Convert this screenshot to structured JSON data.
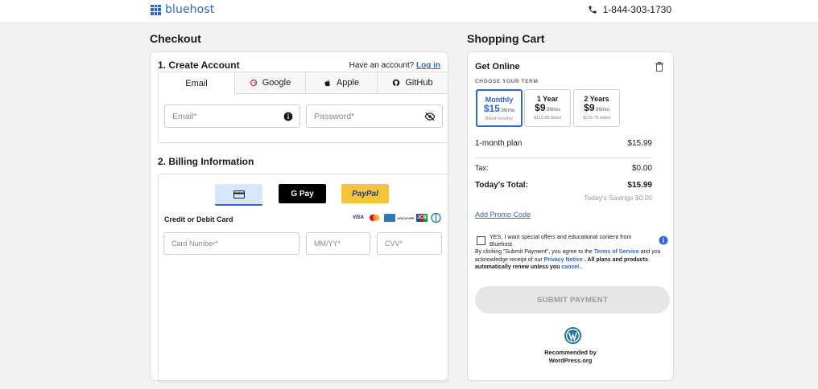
{
  "header": {
    "logo_text": "bluehost",
    "phone": "1-844-303-1730"
  },
  "checkout": {
    "title": "Checkout",
    "create_account": "1. Create Account",
    "have_account": "Have an account?",
    "login": "Log in",
    "tabs": [
      {
        "label": "Email",
        "icon": "envelope"
      },
      {
        "label": "Google",
        "icon": "google-icon"
      },
      {
        "label": "Apple",
        "icon": "apple-icon"
      },
      {
        "label": "GitHub",
        "icon": "github-icon"
      }
    ],
    "email_placeholder": "Email*",
    "password_placeholder": "Password*",
    "billing_title": "2. Billing Information",
    "pay_options": {
      "card": "card-icon",
      "gpay": "G Pay",
      "paypal": "PayPal"
    },
    "card_label": "Credit or Debit Card",
    "brands": [
      "VISA",
      "mastercard",
      "amex",
      "DISCOVER",
      "JCB",
      "Diners"
    ],
    "card_number_placeholder": "Card Number*",
    "expiry_placeholder": "MM/YY*",
    "cvv_placeholder": "CVV*"
  },
  "cart": {
    "title": "Shopping Cart",
    "product": "Get Online",
    "choose_term": "CHOOSE YOUR TERM",
    "terms": [
      {
        "name": "Monthly",
        "price": "$15",
        "cents": ".99/mo",
        "billed": "Billed monthly",
        "selected": true
      },
      {
        "name": "1 Year",
        "price": "$9",
        "cents": ".99/mo",
        "billed": "$119.88 billed",
        "selected": false
      },
      {
        "name": "2 Years",
        "price": "$9",
        "cents": ".99/mo",
        "billed": "$239.76 billed",
        "selected": false
      }
    ],
    "plan_label": "1-month plan",
    "plan_price": "$15.99",
    "tax_label": "Tax:",
    "tax_value": "$0.00",
    "total_label": "Today's Total:",
    "total_value": "$15.99",
    "savings": "Today's Savings $0.00",
    "promo": "Add Promo Code",
    "offer_text": "YES, I want special offers and educational content from Bluehost.",
    "legal_1": "By clicking \"Submit Payment\", you agree to the",
    "terms_link": "Terms of Service",
    "legal_2": "and you acknowledge receipt of our",
    "privacy_link": "Privacy Notice",
    "legal_3": ". All plans and products automatically renew unless you",
    "cancel_link": "cancel",
    "legal_4": ".",
    "submit": "SUBMIT PAYMENT",
    "recommended": "Recommended by",
    "wordpress": "WordPress.org"
  }
}
